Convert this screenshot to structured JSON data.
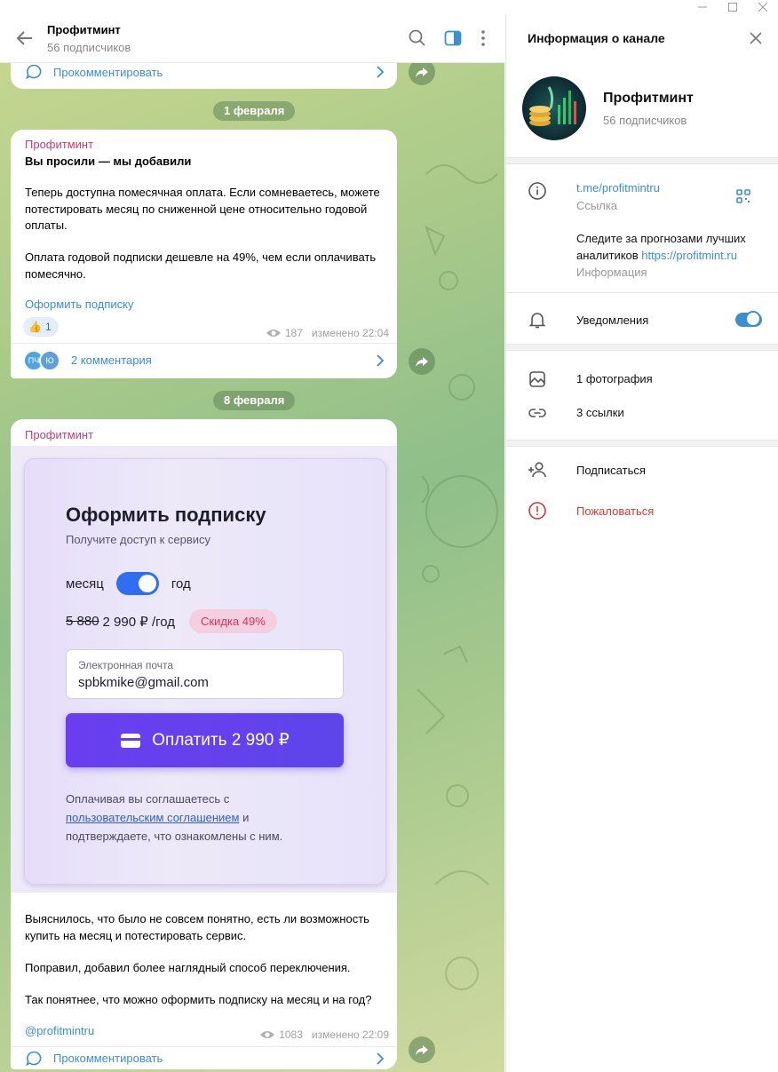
{
  "chat": {
    "title": "Профитминт",
    "subtitle": "56 подписчиков",
    "top_comment": "Прокомментировать",
    "dates": [
      "1 февраля",
      "8 февраля"
    ],
    "post1": {
      "author": "Профитминт",
      "heading": "Вы просили — мы добавили",
      "para1": "Теперь доступна помесячная оплата. Если сомневаетесь, можете потестировать месяц по сниженной цене относительно годовой оплаты.",
      "para2": "Оплата годовой подписки дешевле на 49%, чем если оплачивать помесячно.",
      "link": "Оформить подписку",
      "reaction_emoji": "👍",
      "reaction_count": "1",
      "views": "187",
      "edited": "изменено 22:04",
      "commenters": [
        "ПЧ",
        "Ю"
      ],
      "comments": "2 комментария"
    },
    "post2": {
      "author": "Профитминт",
      "card": {
        "title": "Оформить подписку",
        "subtitle": "Получите доступ к сервису",
        "left_label": "месяц",
        "right_label": "год",
        "old_price": "5 880",
        "new_price": "2 990 ₽ /год",
        "discount": "Скидка 49%",
        "email_label": "Электронная почта",
        "email_value": "spbkmike@gmail.com",
        "pay_button": "Оплатить 2 990 ₽",
        "agree_1": "Оплачивая вы соглашаетесь с",
        "agree_link": "пользовательским соглашением",
        "agree_2": "и",
        "agree_3": "подтверждаете, что ознакомлены с ним."
      },
      "para1": "Выяснилось, что было не совсем понятно, есть ли возможность купить на месяц и потестировать сервис.",
      "para2": "Поправил, добавил более наглядный способ переключения.",
      "para3": "Так понятнее, что можно оформить подписку на месяц и на год?",
      "handle": "@profitmintru",
      "views": "1083",
      "edited": "изменено 22:09",
      "comment": "Прокомментировать"
    }
  },
  "panel": {
    "title": "Информация о канале",
    "name": "Профитминт",
    "subscribers": "56 подписчиков",
    "link": "t.me/profitmintru",
    "link_caption": "Ссылка",
    "info_line1": "Следите за прогнозами лучших",
    "info_line2_text": "аналитиков",
    "info_line2_link": "https://profitmint.ru",
    "info_caption": "Информация",
    "notifications": "Уведомления",
    "notifications_on": true,
    "photos": "1 фотография",
    "links": "3 ссылки",
    "subscribe": "Подписаться",
    "report": "Пожаловаться"
  }
}
